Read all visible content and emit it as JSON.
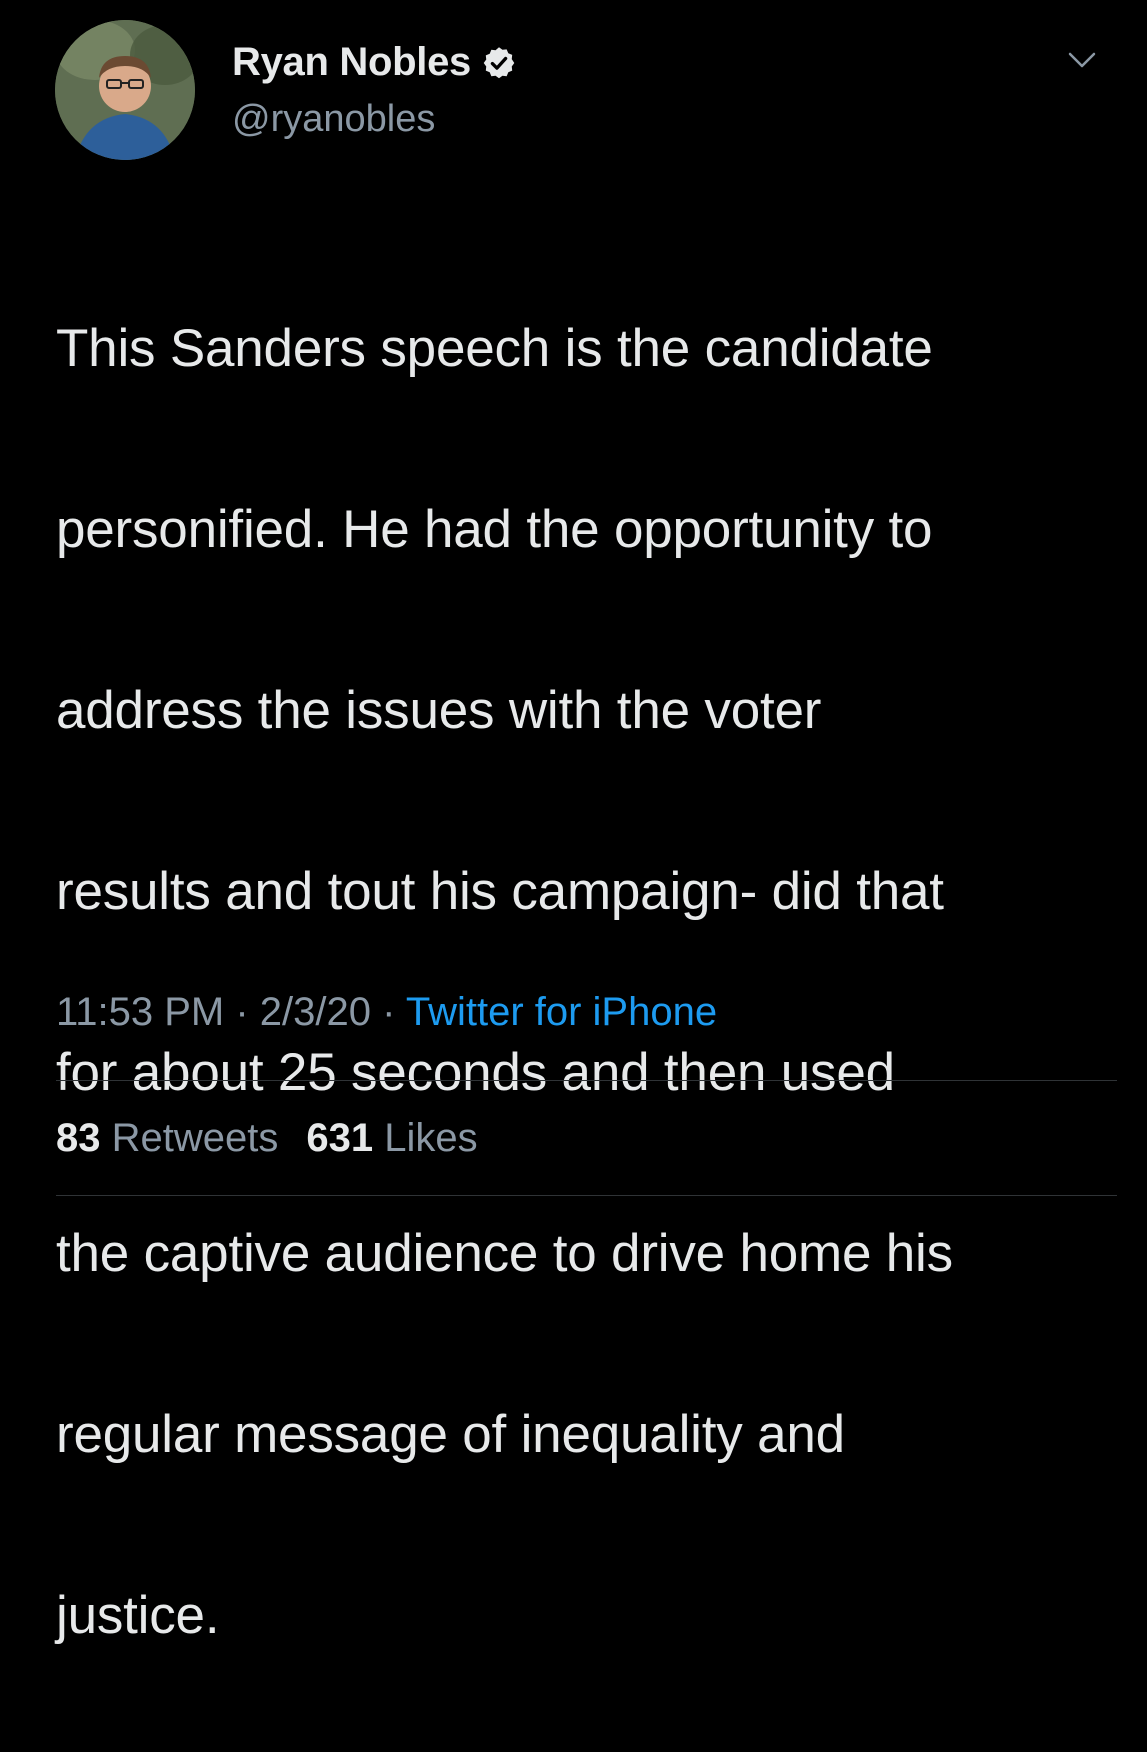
{
  "user": {
    "display_name": "Ryan Nobles",
    "handle": "@ryanobles",
    "verified": true,
    "avatar_icon": "profile-photo"
  },
  "tweet": {
    "lines": [
      "This Sanders speech is the candidate",
      "personified. He had the opportunity to",
      "address the issues with the voter",
      "results and tout his campaign- did that",
      "for about 25 seconds and then used",
      "the captive audience to drive home his",
      "regular message of inequality and",
      "justice."
    ]
  },
  "meta": {
    "time": "11:53 PM",
    "separator": " · ",
    "date": "2/3/20",
    "source": "Twitter for iPhone"
  },
  "stats": {
    "retweets_count": "83",
    "retweets_label": " Retweets",
    "likes_count": "631",
    "likes_label": " Likes"
  },
  "colors": {
    "background": "#000000",
    "text": "#e7e9ea",
    "secondary": "#8b98a5",
    "link": "#1d9bf0",
    "verified": "#e7e9ea"
  },
  "icons": {
    "verified": "verified-badge-icon",
    "menu": "chevron-down-icon"
  }
}
